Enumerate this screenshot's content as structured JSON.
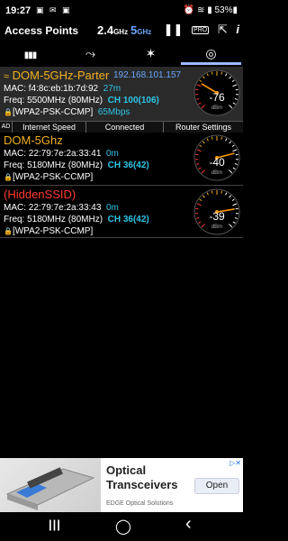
{
  "status_bar": {
    "time": "19:27",
    "left_icons": "▣ ✉ ▣",
    "right": "⏰ ≋ ▮ 53%▮"
  },
  "app_bar": {
    "title": "Access Points",
    "band24": "2.4",
    "band24_unit": "GHz",
    "band5": "5",
    "band5_unit": "GHz",
    "icons": [
      "pause-icon",
      "pro-badge-icon",
      "share-icon",
      "info-icon"
    ],
    "pro_label": "PRO",
    "pause_glyph": "❚❚",
    "share_glyph": "⇱",
    "info_glyph": "i"
  },
  "tabs": [
    {
      "name": "bar-chart-icon",
      "glyph": "▮▮▮"
    },
    {
      "name": "graph-icon",
      "glyph": "⤳"
    },
    {
      "name": "stars-icon",
      "glyph": "✶"
    },
    {
      "name": "signal-icon",
      "glyph": "◎",
      "active": true
    }
  ],
  "access_points": [
    {
      "ssid": "DOM-5GHz-Parter",
      "ip": "192.168.101.157",
      "mac": "MAC: f4:8c:eb:1b:7d:92",
      "distance": "27m",
      "freq": "Freq: 5500MHz  (80MHz)",
      "channel": "CH 100(106)",
      "security": "[WPA2-PSK-CCMP]",
      "speed": "65Mbps",
      "dbm": "-76",
      "level": 0.28,
      "connected": true,
      "lock": "🔒",
      "wifi": "≈",
      "actions": {
        "ad": "AD",
        "internet": "Internet Speed",
        "connected": "Connected",
        "router": "Router Settings"
      }
    },
    {
      "ssid": "DOM-5Ghz",
      "mac": "MAC: 22:79:7e:2a:33:41",
      "distance": "0m",
      "freq": "Freq: 5180MHz  (80MHz)",
      "channel": "CH 36(42)",
      "security": "[WPA2-PSK-CCMP]",
      "dbm": "-40",
      "level": 0.78,
      "lock": "🔒"
    },
    {
      "ssid": "(HiddenSSID)",
      "mac": "MAC: 22:79:7e:2a:33:43",
      "distance": "0m",
      "freq": "Freq: 5180MHz  (80MHz)",
      "channel": "CH 36(42)",
      "security": "[WPA2-PSK-CCMP]",
      "dbm": "-39",
      "level": 0.8,
      "lock": "🔒"
    }
  ],
  "gauge_unit": "dBm",
  "ad": {
    "title": "Optical Transceivers",
    "subtitle": "EDGE Optical Solutions",
    "button": "Open",
    "close": "▷✕"
  },
  "nav": {
    "recents": "|||",
    "home": "◯",
    "back": "‹"
  },
  "colors": {
    "ssid": "#f0b020",
    "hidden": "#ff3b30",
    "accent": "#2ec4e6",
    "ip": "#6aa7ff"
  }
}
